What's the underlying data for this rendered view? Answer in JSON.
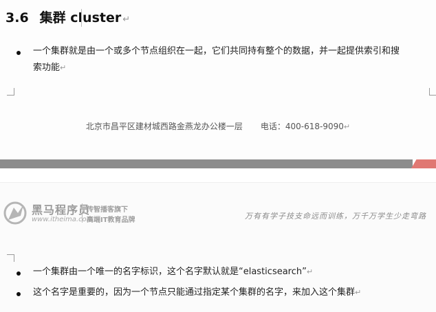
{
  "section": {
    "number": "3.6",
    "title": "集群 cluster",
    "return_mark": "↵"
  },
  "intro_bullet": {
    "line1": "一个集群就是由一个或多个节点组织在一起，它们共同持有整个的数据，并一起提供索引和搜",
    "line2": "索功能",
    "return_mark": "↵"
  },
  "footer": {
    "address": "北京市昌平区建材城西路金燕龙办公楼一层",
    "phone": "电话：400-618-9090",
    "return_mark": "↵"
  },
  "header": {
    "brand_name": "黑马程序员",
    "brand_url": "www.itheima.com",
    "slogan_line1": "传智播客旗下",
    "slogan_line2": "高端IT教育品牌",
    "motto": "万有有学子技支命远而训练，万千万学生少走弯路"
  },
  "bullets": [
    {
      "text": "一个集群由一个唯一的名字标识，这个名字默认就是“elasticsearch”",
      "return_mark": "↵"
    },
    {
      "text": "这个名字是重要的，因为一个节点只能通过指定某个集群的名字，来加入这个集群",
      "return_mark": "↵"
    }
  ],
  "colors": {
    "band_gray": "#8c8c8c",
    "band_red": "#e07873"
  }
}
